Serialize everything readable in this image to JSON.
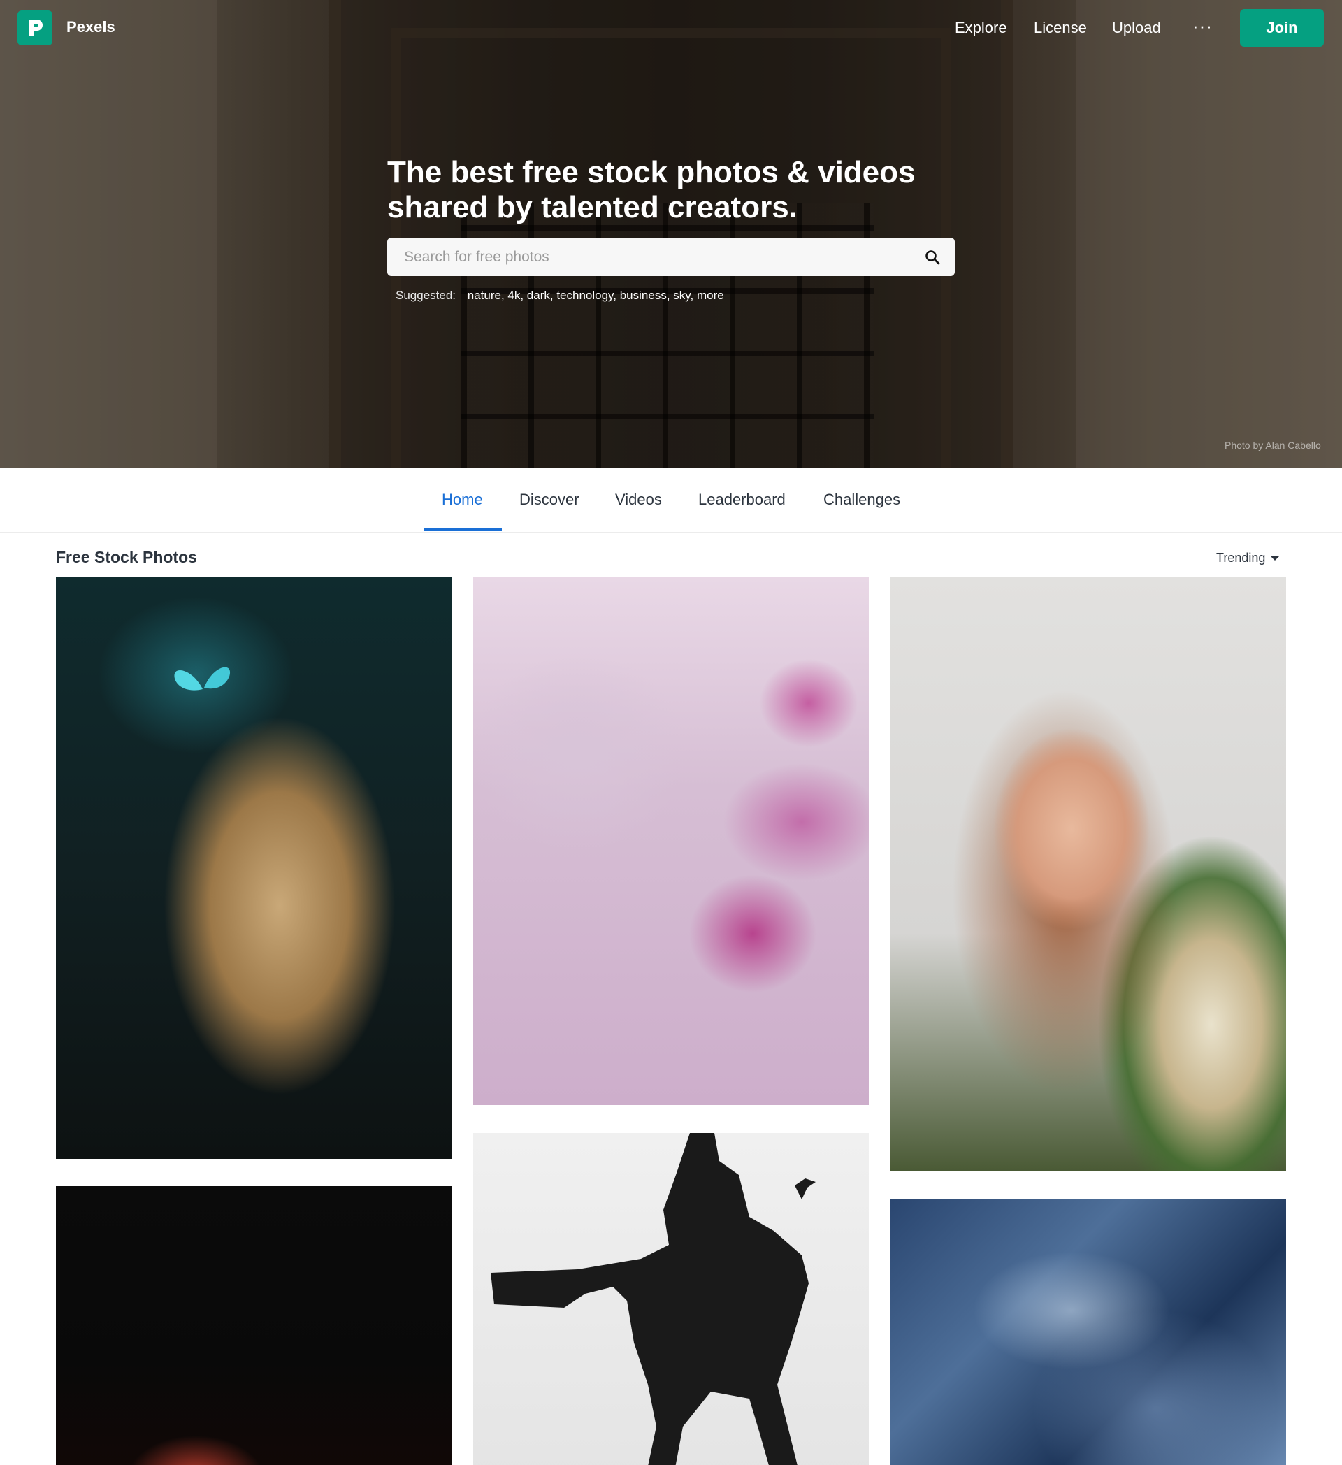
{
  "brand": {
    "name": "Pexels",
    "logo_letter": "P",
    "accent": "#05a081"
  },
  "nav": {
    "links": [
      "Explore",
      "License",
      "Upload"
    ],
    "more": "···",
    "join": "Join"
  },
  "hero": {
    "title": "The best free stock photos & videos shared by talented creators.",
    "search_placeholder": "Search for free photos",
    "search_icon": "search-icon",
    "suggested_label": "Suggested:",
    "suggested": "nature, 4k, dark, technology, business, sky, more",
    "credit": "Photo by Alan Cabello"
  },
  "tabs": {
    "items": [
      "Home",
      "Discover",
      "Videos",
      "Leaderboard",
      "Challenges"
    ],
    "active": "Home",
    "active_color": "#1a6fd6"
  },
  "feed": {
    "title": "Free Stock Photos",
    "sort": "Trending"
  }
}
